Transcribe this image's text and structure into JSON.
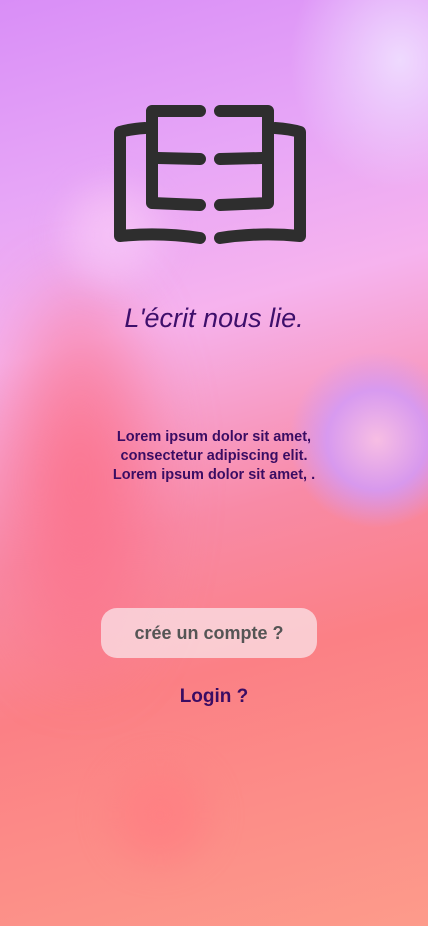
{
  "logo": {
    "icon": "open-book-icon"
  },
  "tagline": "L'écrit nous lie.",
  "description": [
    "Lorem ipsum dolor sit amet,",
    "consectetur adipiscing elit.",
    "Lorem ipsum dolor sit amet, ."
  ],
  "create_account_label": "crée un compte ?",
  "login_label": "Login ?",
  "colors": {
    "text": "#3a0c63",
    "icon": "#2e2e2e"
  }
}
